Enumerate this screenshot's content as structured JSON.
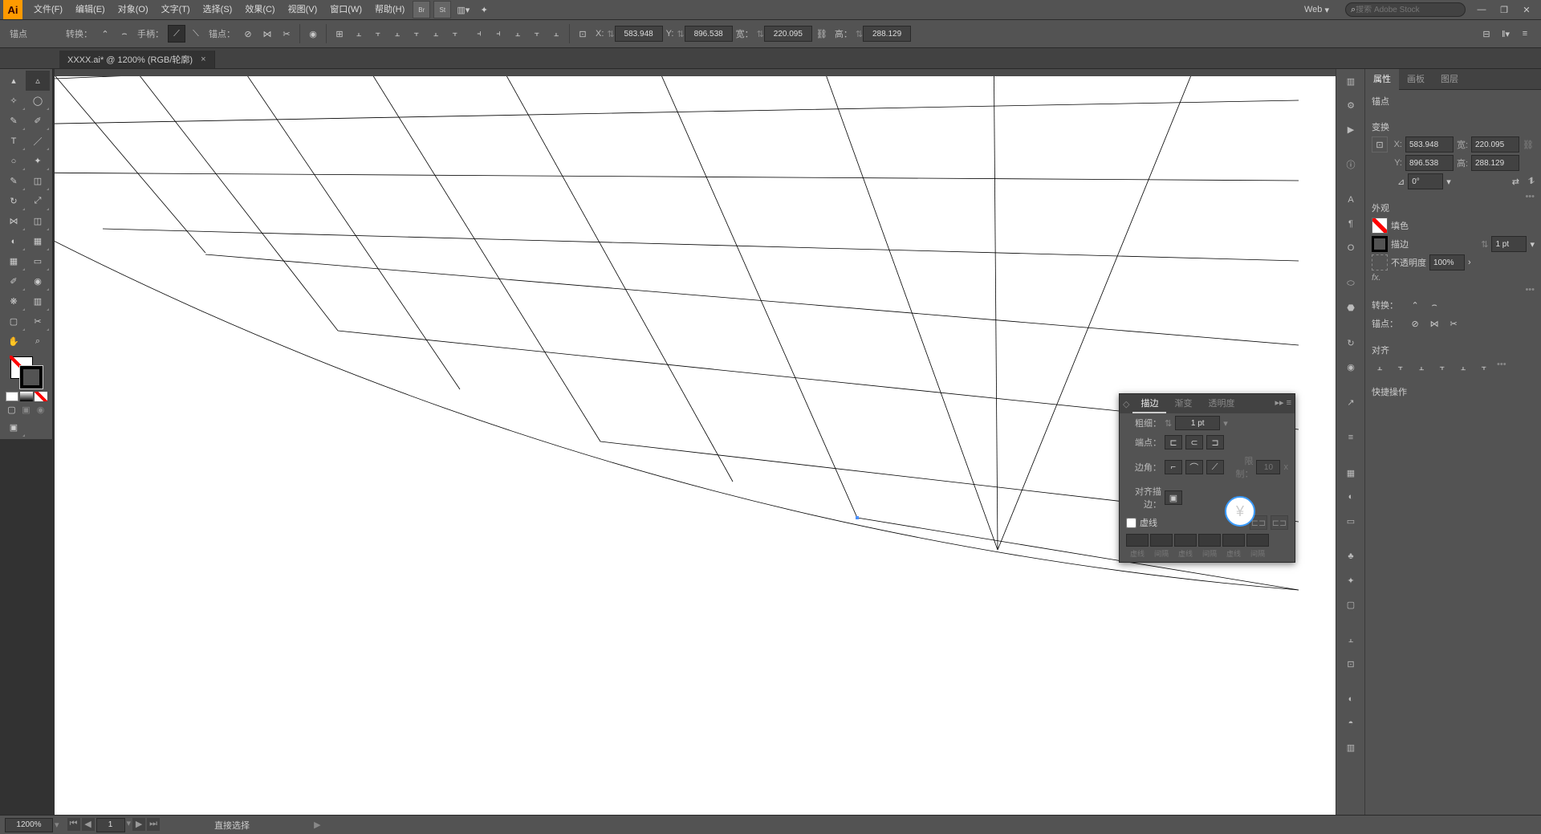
{
  "menu": {
    "file": "文件(F)",
    "edit": "编辑(E)",
    "object": "对象(O)",
    "text": "文字(T)",
    "select": "选择(S)",
    "effect": "效果(C)",
    "view": "视图(V)",
    "window": "窗口(W)",
    "help": "帮助(H)"
  },
  "top": {
    "web": "Web",
    "search_ph": "搜索 Adobe Stock"
  },
  "ctrl": {
    "anchor": "锚点",
    "convert": "转换：",
    "handle": "手柄：",
    "anchors": "锚点：",
    "x": "X:",
    "xv": "583.948",
    "y": "Y:",
    "yv": "896.538",
    "w": "宽：",
    "wv": "220.095",
    "h": "高：",
    "hv": "288.129"
  },
  "tab": {
    "name": "XXXX.ai* @ 1200% (RGB/轮廓)"
  },
  "props": {
    "tab_props": "属性",
    "tab_panels": "画板",
    "tab_layers": "图层",
    "anchor": "锚点",
    "transform": "变换",
    "x": "X:",
    "xv": "583.948",
    "w": "宽:",
    "wv": "220.095",
    "y": "Y:",
    "yv": "896.538",
    "h": "高:",
    "hv": "288.129",
    "angle": "0°",
    "appearance": "外观",
    "fill": "填色",
    "stroke": "描边",
    "stroke_v": "1 pt",
    "opacity": "不透明度",
    "opacity_v": "100%",
    "convert": "转换：",
    "anchors2": "锚点：",
    "align": "对齐",
    "quick": "快捷操作"
  },
  "spanel": {
    "t_stroke": "描边",
    "t_grad": "渐变",
    "t_trans": "透明度",
    "weight": "粗细：",
    "weight_v": "1 pt",
    "cap": "端点：",
    "corner": "边角：",
    "limit": "限制：",
    "limit_v": "10",
    "align": "对齐描边：",
    "dash": "虚线",
    "d1": "虚线",
    "d2": "间隔",
    "d3": "虚线",
    "d4": "间隔",
    "d5": "虚线",
    "d6": "间隔"
  },
  "status": {
    "zoom": "1200%",
    "page": "1",
    "mode": "直接选择"
  }
}
